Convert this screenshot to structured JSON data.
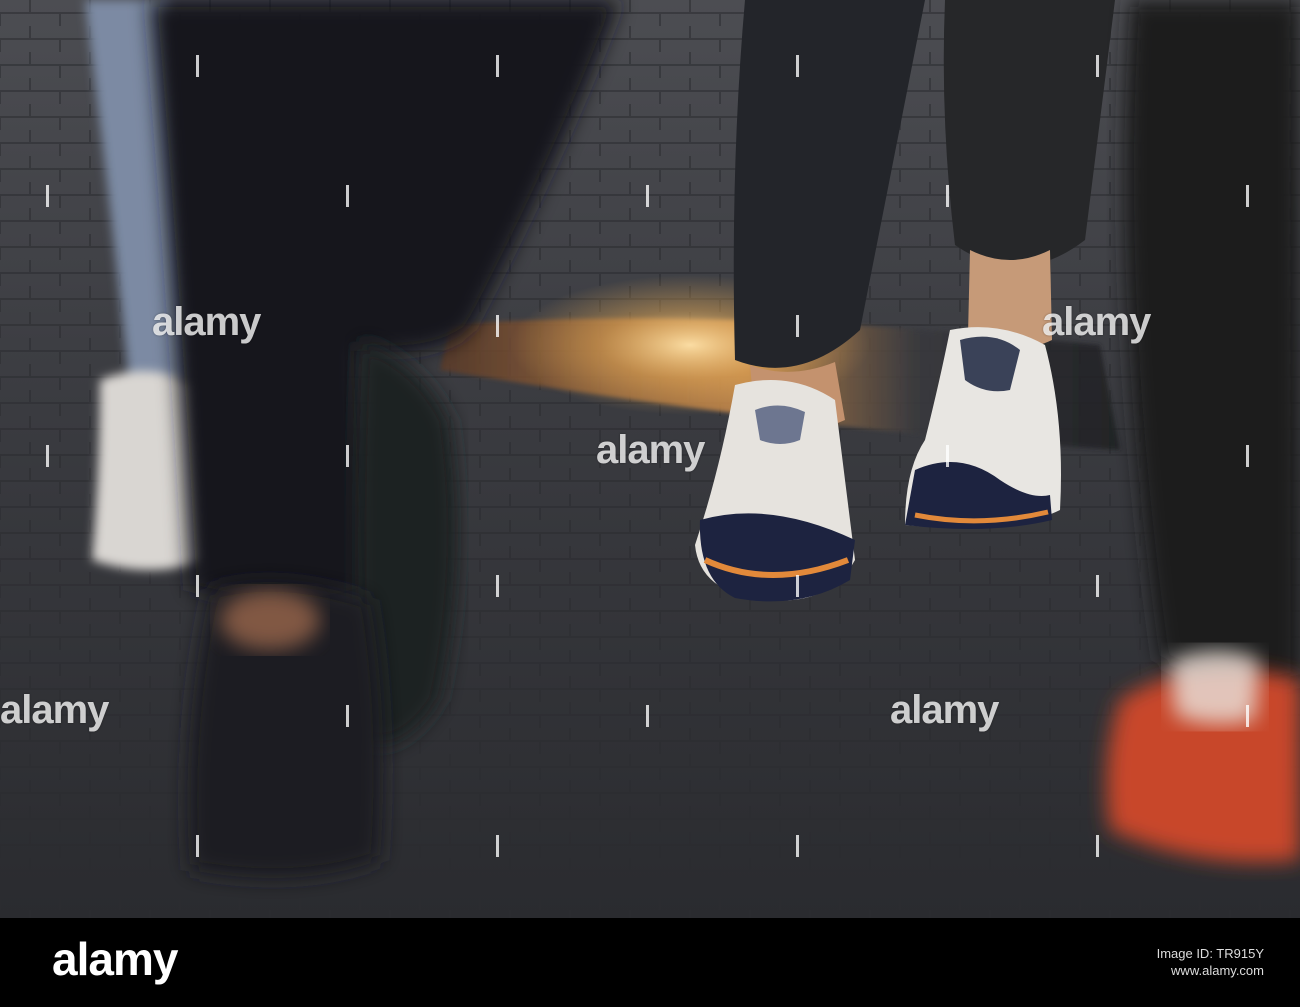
{
  "watermark": {
    "text": "alamy",
    "color": "#ffffff"
  },
  "footer": {
    "brand": "alamy",
    "image_id_label": "Image ID: TR915Y",
    "site": "www.alamy.com"
  },
  "scene": {
    "subject": "legs-walking-on-paved-sidewalk",
    "colors": {
      "pavement": "#3a3b40",
      "jeans": "#23252a",
      "sneaker_white": "#e6e3de",
      "sneaker_navy": "#1d2340",
      "sneaker_red": "#c8462c",
      "sunlight": "#f2c98a"
    }
  }
}
